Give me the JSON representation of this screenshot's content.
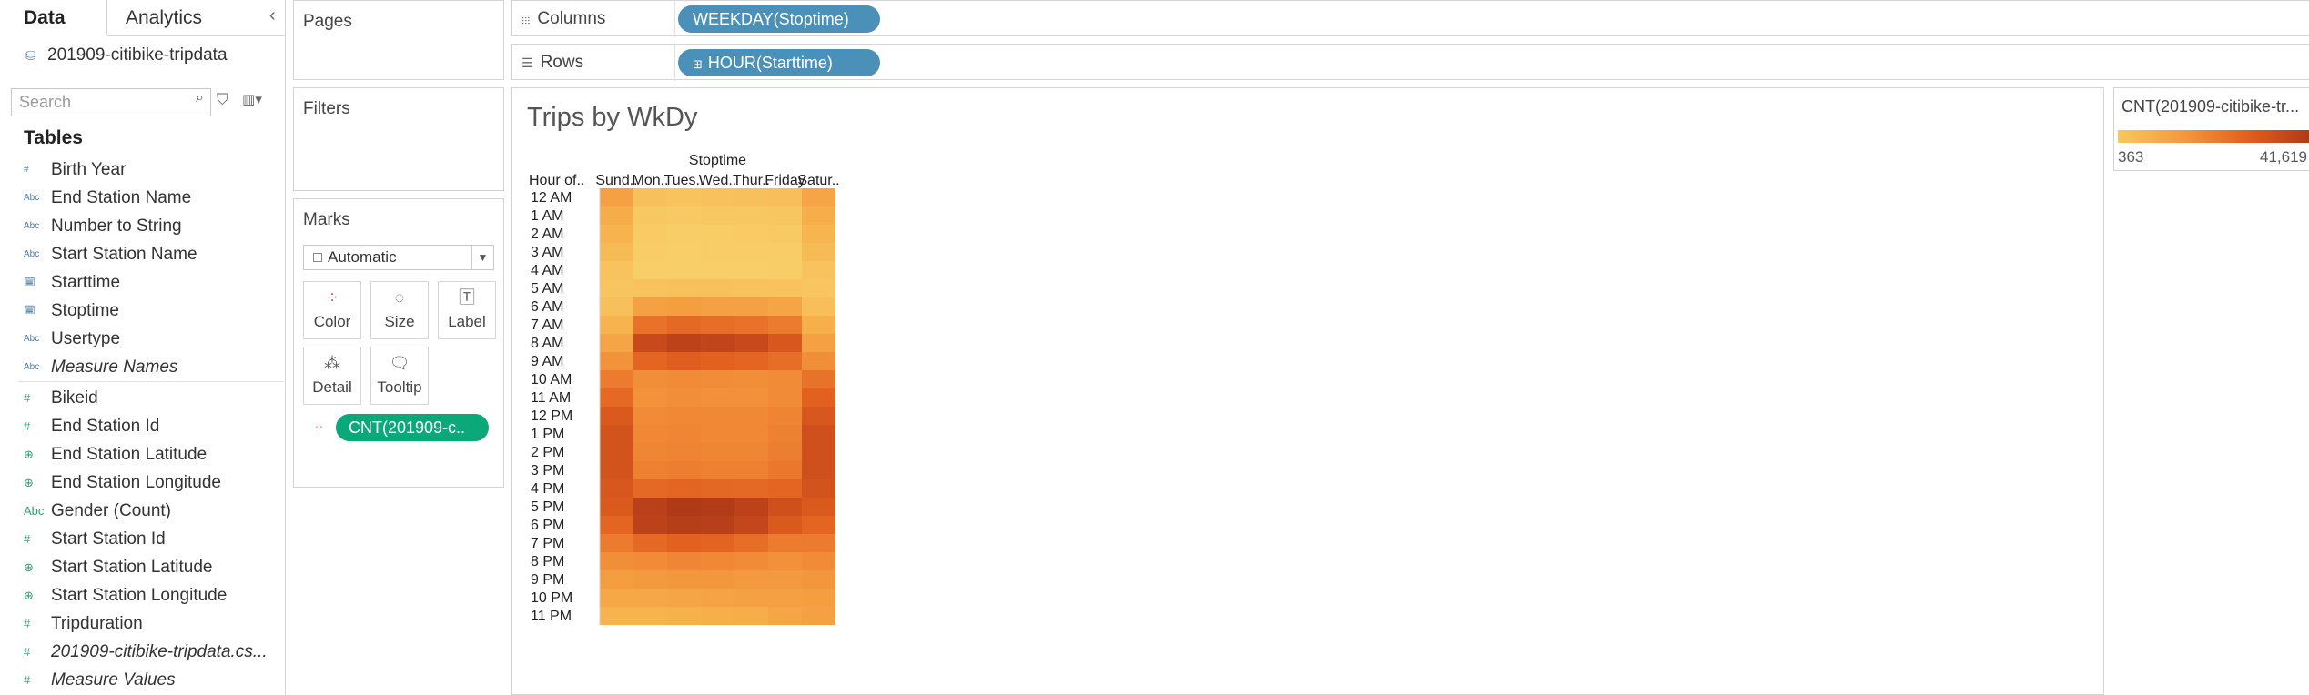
{
  "data_pane": {
    "tabs": [
      "Data",
      "Analytics"
    ],
    "datasource": "201909-citibike-tripdata",
    "search_placeholder": "Search",
    "tables_heading": "Tables",
    "dimensions": [
      {
        "label": "Birth Year",
        "icon": "#",
        "italic": false
      },
      {
        "label": "End Station Name",
        "icon": "Abc",
        "italic": false
      },
      {
        "label": "Number to String",
        "icon": "Abc",
        "italic": false
      },
      {
        "label": "Start Station Name",
        "icon": "Abc",
        "italic": false
      },
      {
        "label": "Starttime",
        "icon": "date",
        "italic": false
      },
      {
        "label": "Stoptime",
        "icon": "date",
        "italic": false
      },
      {
        "label": "Usertype",
        "icon": "Abc",
        "italic": false
      },
      {
        "label": "Measure Names",
        "icon": "Abc",
        "italic": true
      }
    ],
    "measures": [
      {
        "label": "Bikeid",
        "icon": "#",
        "italic": false
      },
      {
        "label": "End Station Id",
        "icon": "#",
        "italic": false
      },
      {
        "label": "End Station Latitude",
        "icon": "globe",
        "italic": false
      },
      {
        "label": "End Station Longitude",
        "icon": "globe",
        "italic": false
      },
      {
        "label": "Gender (Count)",
        "icon": "Abc",
        "italic": false
      },
      {
        "label": "Start Station Id",
        "icon": "#",
        "italic": false
      },
      {
        "label": "Start Station Latitude",
        "icon": "globe",
        "italic": false
      },
      {
        "label": "Start Station Longitude",
        "icon": "globe",
        "italic": false
      },
      {
        "label": "Tripduration",
        "icon": "#",
        "italic": false
      },
      {
        "label": "201909-citibike-tripdata.cs...",
        "icon": "#",
        "italic": true
      },
      {
        "label": "Measure Values",
        "icon": "#",
        "italic": true
      }
    ]
  },
  "cards": {
    "pages": "Pages",
    "filters": "Filters",
    "marks": "Marks",
    "mark_type": "Automatic",
    "mark_buttons": [
      "Color",
      "Size",
      "Label",
      "Detail",
      "Tooltip"
    ],
    "color_pill": "CNT(201909-c.."
  },
  "shelves": {
    "columns_label": "Columns",
    "columns_pill": "WEEKDAY(Stoptime)",
    "rows_label": "Rows",
    "rows_pill": "HOUR(Starttime)"
  },
  "view": {
    "title": "Trips by WkDy"
  },
  "legend": {
    "title": "CNT(201909-citibike-tr...",
    "min": "363",
    "max": "41,619"
  },
  "chart_data": {
    "type": "heatmap",
    "title": "Trips by WkDy",
    "column_header": "Stoptime",
    "row_header": "Hour of..",
    "columns": [
      "Sund..",
      "Mon..",
      "Tues..",
      "Wed..",
      "Thur..",
      "Friday",
      "Satur.."
    ],
    "rows": [
      "12 AM",
      "1 AM",
      "2 AM",
      "3 AM",
      "4 AM",
      "5 AM",
      "6 AM",
      "7 AM",
      "8 AM",
      "9 AM",
      "10 AM",
      "11 AM",
      "12 PM",
      "1 PM",
      "2 PM",
      "3 PM",
      "4 PM",
      "5 PM",
      "6 PM",
      "7 PM",
      "8 PM",
      "9 PM",
      "10 PM",
      "11 PM"
    ],
    "color_range": [
      363,
      41619
    ],
    "color_scale": [
      "#f8cf6a",
      "#f7b24d",
      "#f49a3e",
      "#ee8032",
      "#e2611f",
      "#c94a1c",
      "#b03a18"
    ],
    "values": [
      [
        12000,
        4000,
        3500,
        3800,
        3900,
        4500,
        11000
      ],
      [
        9000,
        2000,
        1800,
        2000,
        2100,
        2600,
        8500
      ],
      [
        7000,
        1200,
        1000,
        1100,
        1200,
        1600,
        6500
      ],
      [
        5000,
        800,
        700,
        800,
        850,
        1000,
        5000
      ],
      [
        3500,
        700,
        650,
        700,
        700,
        900,
        3500
      ],
      [
        3000,
        3500,
        3800,
        3600,
        3500,
        3300,
        2800
      ],
      [
        4000,
        12000,
        13000,
        12500,
        12000,
        11000,
        4500
      ],
      [
        7000,
        24000,
        26000,
        25000,
        24000,
        22000,
        8000
      ],
      [
        11000,
        35000,
        38000,
        37000,
        35000,
        31000,
        12000
      ],
      [
        16000,
        27000,
        29000,
        28000,
        27000,
        25000,
        17000
      ],
      [
        22000,
        17000,
        18000,
        17500,
        17000,
        18000,
        24000
      ],
      [
        26000,
        16000,
        17000,
        16500,
        16500,
        18000,
        28000
      ],
      [
        30000,
        18000,
        19000,
        18500,
        18500,
        20000,
        31000
      ],
      [
        32000,
        19000,
        19500,
        19000,
        19000,
        21000,
        33000
      ],
      [
        32000,
        19500,
        20000,
        19500,
        19500,
        21500,
        33000
      ],
      [
        32000,
        21000,
        21500,
        21000,
        21000,
        23000,
        33000
      ],
      [
        31000,
        26000,
        27000,
        26500,
        26000,
        27000,
        32000
      ],
      [
        30000,
        39000,
        41619,
        41000,
        38000,
        33000,
        30000
      ],
      [
        27000,
        38000,
        40000,
        39500,
        36000,
        30000,
        27000
      ],
      [
        22000,
        26000,
        28000,
        27500,
        25000,
        22000,
        22000
      ],
      [
        17000,
        18000,
        19500,
        19000,
        18000,
        16500,
        18000
      ],
      [
        13000,
        14000,
        15000,
        15000,
        14500,
        14000,
        15000
      ],
      [
        10000,
        10500,
        11000,
        11500,
        12000,
        12500,
        13000
      ],
      [
        7000,
        7000,
        7500,
        8000,
        8500,
        11000,
        12000
      ]
    ]
  }
}
